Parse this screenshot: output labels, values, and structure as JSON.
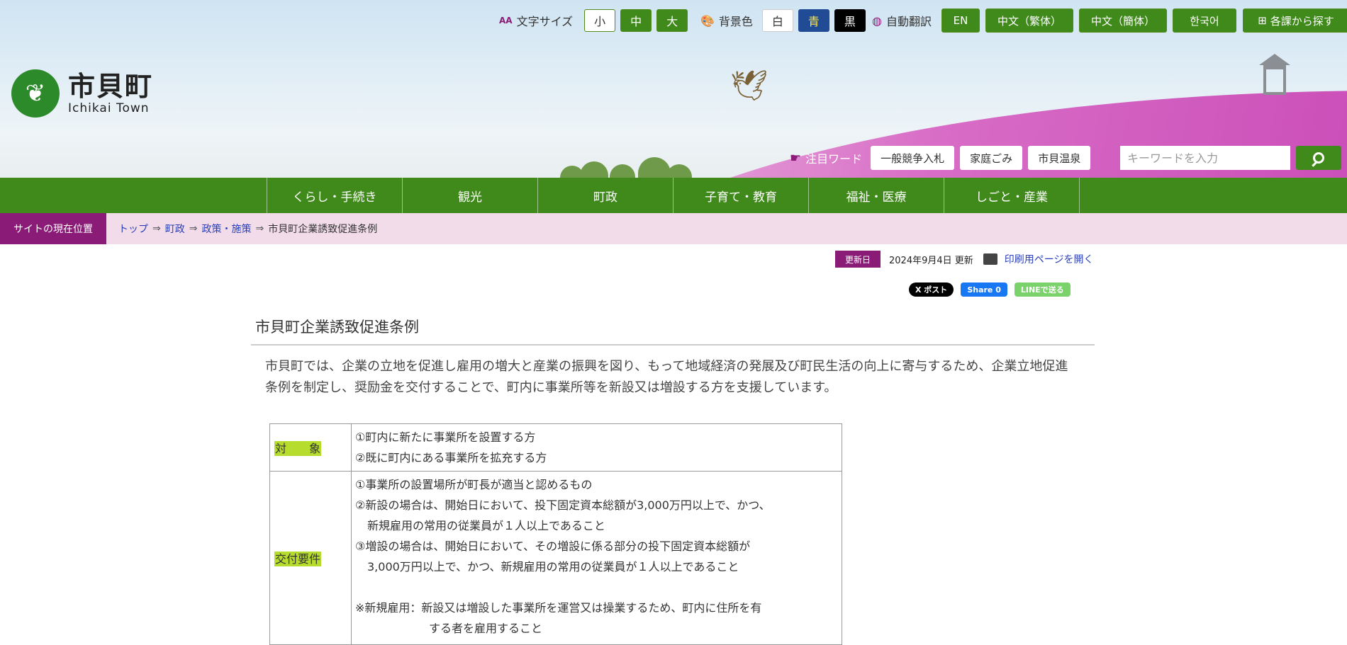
{
  "toolbar": {
    "fontsize_label": "文字サイズ",
    "fontsize_icon": "AA",
    "fontsize_options": [
      "小",
      "中",
      "大"
    ],
    "bgcolor_label": "背景色",
    "bgcolor_options": [
      "白",
      "青",
      "黒"
    ],
    "translate_label": "自動翻訳",
    "languages": [
      "EN",
      "中文（繁体）",
      "中文（簡体）",
      "한국어"
    ],
    "dept_search": "各課から探す"
  },
  "logo": {
    "jp": "市貝町",
    "en": "Ichikai Town"
  },
  "hotwords": {
    "label": "注目ワード",
    "items": [
      "一般競争入札",
      "家庭ごみ",
      "市貝温泉"
    ]
  },
  "search": {
    "placeholder": "キーワードを入力"
  },
  "nav": [
    "くらし・手続き",
    "観光",
    "町政",
    "子育て・教育",
    "福祉・医療",
    "しごと・産業"
  ],
  "breadcrumb": {
    "label": "サイトの現在位置",
    "items": [
      "トップ",
      "町政",
      "政策・施策"
    ],
    "separator": "⇒",
    "current": "市貝町企業誘致促進条例"
  },
  "meta": {
    "updated_badge": "更新日",
    "updated_date": "2024年9月4日 更新",
    "print": "印刷用ページを開く"
  },
  "share": {
    "x": "X ポスト",
    "facebook": "Share 0",
    "line": "LINEで送る"
  },
  "page": {
    "title": "市貝町企業誘致促進条例",
    "lead": "市貝町では、企業の立地を促進し雇用の増大と産業の振興を図り、もって地域経済の発展及び町民生活の向上に寄与するため、企業立地促進条例を制定し、奨励金を交付することで、町内に事業所等を新設又は増設する方を支援しています。"
  },
  "table": {
    "target": {
      "key": "対　　象",
      "lines": [
        "①町内に新たに事業所を設置する方",
        "②既に町内にある事業所を拡充する方"
      ]
    },
    "requirements": {
      "key": "交付要件",
      "line1": "①事業所の設置場所が町長が適当と認めるもの",
      "line2a": "②新設の場合は、開始日において、投下固定資本総額が3,000万円以上で、かつ、",
      "line2b": "新規雇用の常用の従業員が１人以上であること",
      "line3a": "③増設の場合は、開始日において、その増設に係る部分の投下固定資本総額が",
      "line3b": "3,000万円以上で、かつ、新規雇用の常用の従業員が１人以上であること",
      "note_a": "※新規雇用：新設又は増設した事業所を運営又は操業するため、町内に住所を有",
      "note_b": "する者を雇用すること"
    }
  },
  "colors": {
    "green": "#3f8a1a",
    "purple": "#8a1c78",
    "crumb_bg": "#f2dcea",
    "highlight": "#b6dc2e"
  }
}
